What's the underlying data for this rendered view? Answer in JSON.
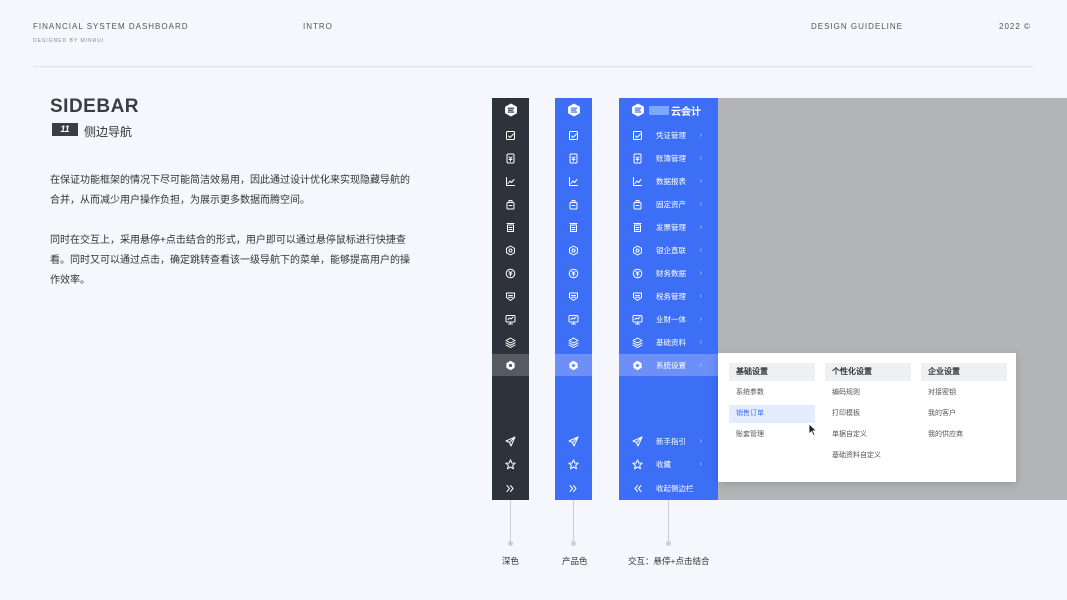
{
  "header": {
    "title": "FINANCIAL  SYSTEM DASHBOARD",
    "designer": "DESIGNED BY MINRUI",
    "intro": "INTRO",
    "guideline": "DESIGN GUIDELINE",
    "year": "2022 ©"
  },
  "section": {
    "title": "SIDEBAR",
    "number": "11",
    "subtitle": "侧边导航",
    "para1": "在保证功能框架的情况下尽可能简洁效易用，因此通过设计优化来实现隐藏导航的合并，从而减少用户操作负担，为展示更多数据而腾空间。",
    "para2": "同时在交互上，采用悬停+点击结合的形式，用户即可以通过悬停鼠标进行快捷查看。同时又可以通过点击，确定跳转查看该一级导航下的菜单，能够提高用户的操作效率。"
  },
  "brand": {
    "name": "云会计"
  },
  "nav": {
    "items": [
      {
        "label": "凭证管理",
        "icon": "voucher-icon"
      },
      {
        "label": "账簿管理",
        "icon": "ledger-icon"
      },
      {
        "label": "数据报表",
        "icon": "chart-icon"
      },
      {
        "label": "固定资产",
        "icon": "asset-icon"
      },
      {
        "label": "发票管理",
        "icon": "invoice-icon"
      },
      {
        "label": "银企直联",
        "icon": "bank-icon"
      },
      {
        "label": "财务数据",
        "icon": "finance-icon"
      },
      {
        "label": "税务管理",
        "icon": "tax-icon"
      },
      {
        "label": "业财一体",
        "icon": "monitor-icon"
      },
      {
        "label": "基础资料",
        "icon": "layers-icon"
      },
      {
        "label": "系统设置",
        "icon": "settings-icon"
      }
    ],
    "bottom": [
      {
        "label": "新手指引",
        "icon": "send-icon"
      },
      {
        "label": "收藏",
        "icon": "star-icon"
      },
      {
        "label": "收起侧边栏",
        "icon": "collapse-icon"
      }
    ],
    "active_index": 10
  },
  "flyout": {
    "columns": [
      {
        "title": "基础设置",
        "items": [
          "系统参数",
          "销售订单",
          "账套管理"
        ]
      },
      {
        "title": "个性化设置",
        "items": [
          "编码规则",
          "打印模板",
          "单据自定义",
          "基础资料自定义"
        ]
      },
      {
        "title": "企业设置",
        "items": [
          "对接密钥",
          "我的客户",
          "我的供应商"
        ]
      }
    ],
    "selected": "销售订单"
  },
  "captions": {
    "dark": "深色",
    "product": "产品色",
    "interaction": "交互：悬停+点击结合"
  },
  "colors": {
    "dark": "#2d323b",
    "brand": "#3c6ff6",
    "accent_active": "#6c8ff8"
  }
}
